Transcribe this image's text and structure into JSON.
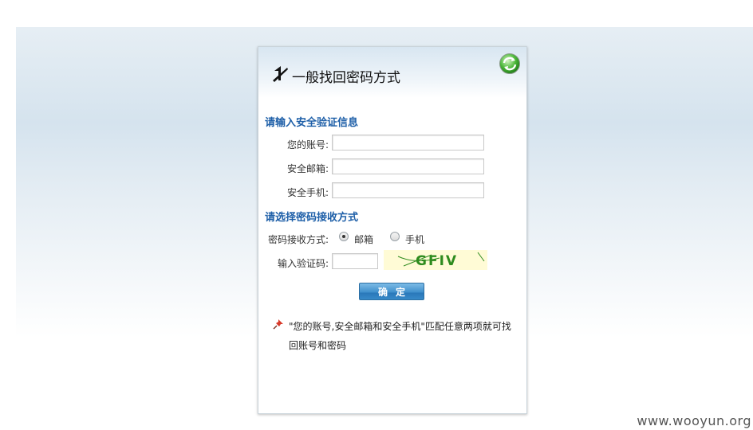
{
  "dialog": {
    "title": "一般找回密码方式"
  },
  "security_section": {
    "title": "请输入安全验证信息",
    "account_label": "您的账号:",
    "account_value": "",
    "email_label": "安全邮箱:",
    "email_value": "",
    "phone_label": "安全手机:",
    "phone_value": ""
  },
  "receive_section": {
    "title": "请选择密码接收方式",
    "method_label": "密码接收方式:",
    "options": [
      {
        "label": "邮箱",
        "checked": true
      },
      {
        "label": "手机",
        "checked": false
      }
    ],
    "captcha_label": "输入验证码:",
    "captcha_value": "",
    "captcha_text": "GFIV"
  },
  "submit_label": "确定",
  "note": {
    "line1": "\"您的账号,安全邮箱和安全手机\"匹配任意两项就可找",
    "line2": "回账号和密码"
  },
  "watermark": "www.wooyun.org",
  "colors": {
    "section_title": "#1e5fa8",
    "button": "#2a78b9",
    "captcha_bg": "#fffbd6",
    "captcha_text": "#2e8b1e"
  }
}
